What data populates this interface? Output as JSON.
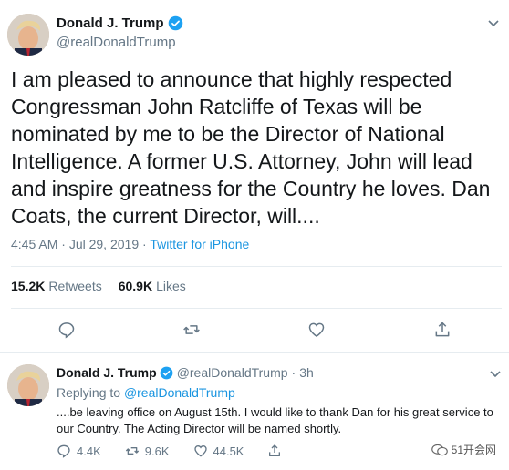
{
  "main_tweet": {
    "display_name": "Donald J. Trump",
    "handle": "@realDonaldTrump",
    "text": "I am pleased to announce that highly respected Congressman John Ratcliffe of Texas will be nominated by me to be the Director of National Intelligence. A former U.S. Attorney, John will lead and inspire greatness for the Country he loves. Dan Coats, the current Director, will....",
    "time": "4:45 AM",
    "date": "Jul 29, 2019",
    "separator": "·",
    "source": "Twitter for iPhone",
    "retweets_count": "15.2K",
    "retweets_label": "Retweets",
    "likes_count": "60.9K",
    "likes_label": "Likes",
    "icons": [
      "reply-icon",
      "retweet-icon",
      "like-icon",
      "share-icon"
    ]
  },
  "reply_tweet": {
    "display_name": "Donald J. Trump",
    "handle": "@realDonaldTrump",
    "separator": "·",
    "age": "3h",
    "replying_prefix": "Replying to",
    "replying_to": "@realDonaldTrump",
    "text": "....be leaving office on August 15th. I would like to thank Dan for his great service to our Country. The Acting Director will be named shortly.",
    "reply_count": "4.4K",
    "retweet_count": "9.6K",
    "like_count": "44.5K"
  },
  "watermark": {
    "text": "51开会网"
  },
  "colors": {
    "link": "#1b95e0",
    "muted": "#657786",
    "text": "#14171a",
    "verified": "#1da1f2"
  }
}
